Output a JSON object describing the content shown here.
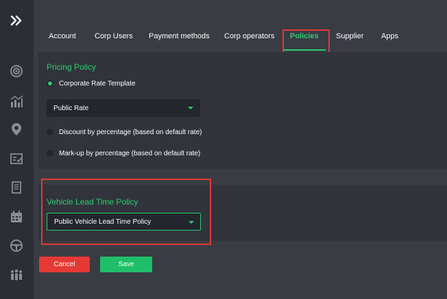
{
  "colors": {
    "accent": "#2ecc71",
    "danger": "#e53935",
    "background": "#393c43",
    "panel": "#31343b",
    "sidebar": "#2b2e35"
  },
  "sidebar": {
    "icons": [
      "expand-icon",
      "target-icon",
      "analytics-icon",
      "location-pin-icon",
      "checklist-icon",
      "document-icon",
      "calendar-icon",
      "steering-wheel-icon",
      "group-icon"
    ]
  },
  "tabs": [
    {
      "label": "Account"
    },
    {
      "label": "Corp Users"
    },
    {
      "label": "Payment methods"
    },
    {
      "label": "Corp operators"
    },
    {
      "label": "Policies",
      "active": true
    },
    {
      "label": "Supplier"
    },
    {
      "label": "Apps"
    }
  ],
  "pricing_policy": {
    "title": "Pricing Policy",
    "options": [
      {
        "label": "Corporate Rate Template",
        "selected": true
      },
      {
        "label": "Discount by percentage (based on default rate)",
        "selected": false
      },
      {
        "label": "Mark-up by percentage (based on default rate)",
        "selected": false
      }
    ],
    "rate_select": {
      "value": "Public Rate"
    }
  },
  "vehicle_lead_time_policy": {
    "title": "Vehicle Lead Time Policy",
    "select": {
      "value": "Public Vehicle Lead Time Policy"
    }
  },
  "actions": {
    "cancel_label": "Cancel",
    "save_label": "Save"
  }
}
